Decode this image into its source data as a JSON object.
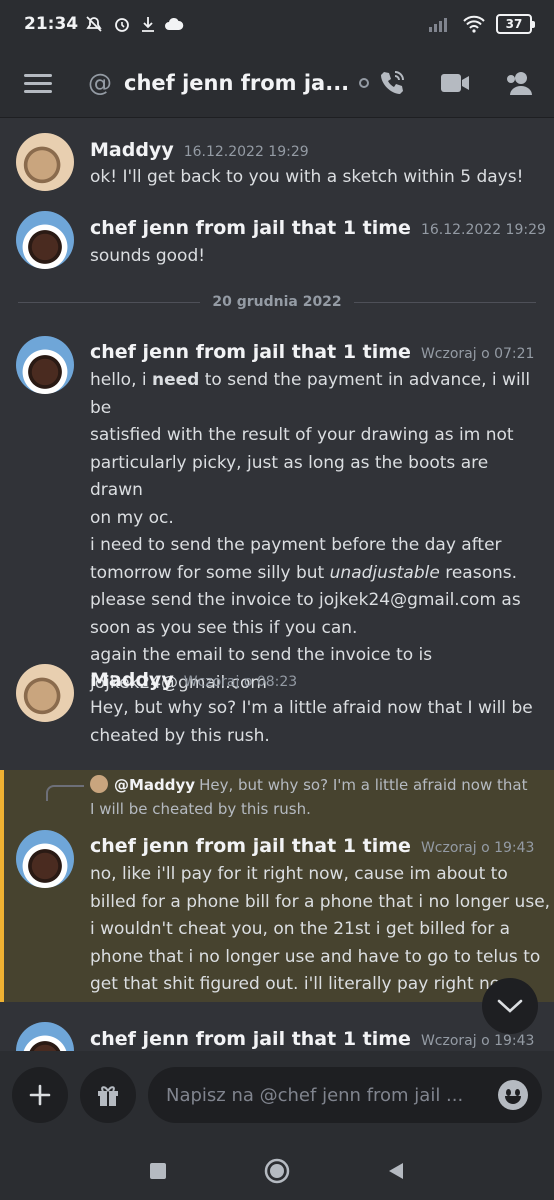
{
  "status_bar": {
    "time": "21:34",
    "battery": "37"
  },
  "header": {
    "channel_name": "chef jenn from ja...",
    "at_symbol": "@"
  },
  "messages": [
    {
      "author": "Maddyy",
      "timestamp": "16.12.2022 19:29",
      "lines": [
        "ok! I'll get back to you with a sketch within 5 days!"
      ]
    },
    {
      "author": "chef jenn from jail that 1 time",
      "timestamp": "16.12.2022 19:29",
      "lines": [
        "sounds good!"
      ]
    },
    {
      "author": "chef jenn from jail that 1 time",
      "timestamp": "Wczoraj o 07:21",
      "lines": [
        "hello, i need to send the payment in advance, i will be",
        "satisfied with the result of your drawing  as im not",
        "particularly picky, just as long as the boots are drawn",
        "on my oc.",
        "i need to send the payment before the day after",
        "tomorrow for some silly but unadjustable reasons.",
        "please send the invoice to jojkek24@gmail.com as",
        "soon as you see this if you can.",
        "again the email to send the invoice to is",
        "jojkek24@gmail.com"
      ]
    },
    {
      "author": "Maddyy",
      "timestamp": "Wczoraj o 08:23",
      "lines": [
        "Hey, but why so? I'm a little afraid now that I will be",
        "cheated by this rush."
      ]
    },
    {
      "author": "chef jenn from jail that 1 time",
      "timestamp": "Wczoraj o 19:43",
      "reply": {
        "mention": "@Maddyy",
        "text": "Hey, but why so? I'm a little afraid now that I will be cheated by this rush."
      },
      "lines": [
        "no, like i'll pay for it right now, cause im about to",
        "billed for a phone bill for a phone that i no longer use,",
        "i wouldn't cheat you, on the 21st i get billed for a",
        "phone that i no longer use and have to go to telus to",
        "get that shit figured out. i'll literally pay right no"
      ]
    },
    {
      "author": "chef jenn from jail that 1 time",
      "timestamp": "Wczoraj o 19:43",
      "lines": []
    }
  ],
  "date_divider": "20 grudnia 2022",
  "emphasis": {
    "bold_word": "need",
    "italic_word": "unadjustable"
  },
  "composer": {
    "placeholder": "Napisz na @chef jenn from jail ..."
  },
  "colors": {
    "background": "#313338",
    "bars": "#2b2d31",
    "highlight": "#47432f",
    "highlight_border": "#f0b232"
  }
}
